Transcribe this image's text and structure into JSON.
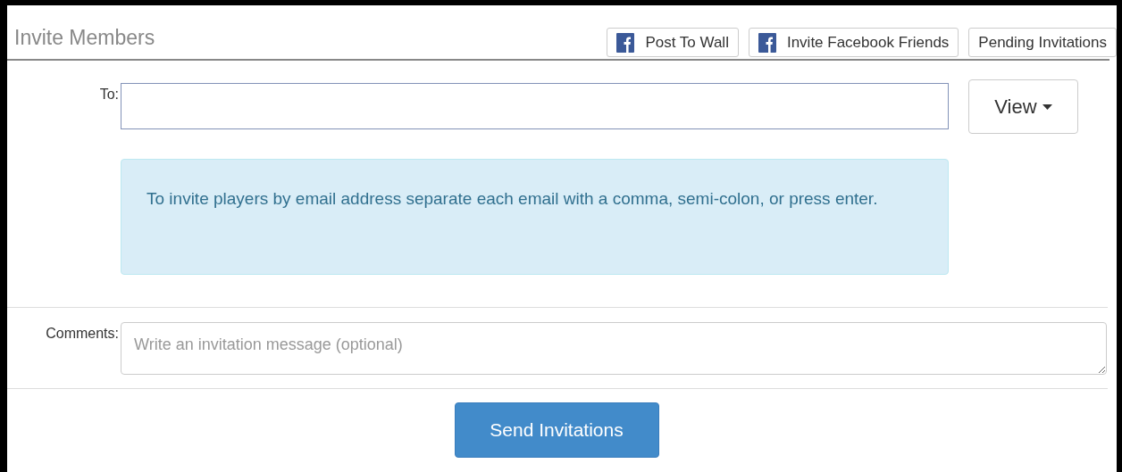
{
  "header": {
    "title": "Invite Members",
    "buttons": [
      {
        "label": "Post To Wall",
        "kind": "facebook"
      },
      {
        "label": "Invite Facebook Friends",
        "kind": "facebook"
      },
      {
        "label": "Pending Invitations",
        "kind": "plain"
      }
    ]
  },
  "to": {
    "label": "To:",
    "view_button": "View"
  },
  "info": "To invite players by email address separate each email with a comma, semi-colon, or press enter.",
  "comments": {
    "label": "Comments:",
    "placeholder": "Write an invitation message (optional)"
  },
  "submit": "Send Invitations"
}
